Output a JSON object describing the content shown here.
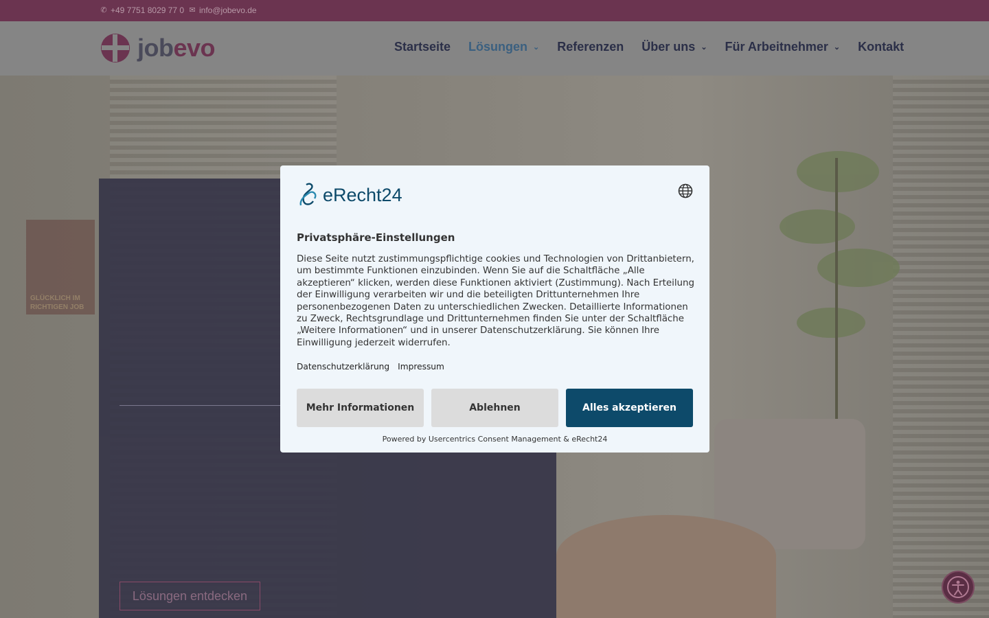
{
  "topbar": {
    "phone": "+49 7751 8029 77 0",
    "email": "info@jobevo.de",
    "phone_icon": "phone-icon",
    "email_icon": "envelope-icon"
  },
  "logo": {
    "text_a": "job",
    "text_b": "evo"
  },
  "nav": {
    "items": [
      {
        "label": "Startseite",
        "dropdown": false
      },
      {
        "label": "Lösungen",
        "dropdown": true,
        "active": true
      },
      {
        "label": "Referenzen",
        "dropdown": false
      },
      {
        "label": "Über uns",
        "dropdown": true
      },
      {
        "label": "Für Arbeitnehmer",
        "dropdown": true
      },
      {
        "label": "Kontakt",
        "dropdown": false
      }
    ]
  },
  "hero": {
    "cta_label": "Lösungen entdecken",
    "poster_text_1": "GLÜCKLICH IM",
    "poster_text_2": "RICHTIGEN JOB"
  },
  "consent": {
    "brand": "eRecht24",
    "title": "Privatsphäre-Einstellungen",
    "body": "Diese Seite nutzt zustimmungspflichtige cookies und Technologien von Drittanbietern, um bestimmte Funktionen einzubinden. Wenn Sie auf die Schaltfläche „Alle akzeptieren“ klicken, werden diese Funktionen aktiviert (Zustimmung). Nach Erteilung der Einwilligung verarbeiten wir und die beteiligten Drittunternehmen Ihre personenbezogenen Daten zu unterschiedlichen Zwecken. Detaillierte Informationen zu Zweck, Rechtsgrundlage und Drittunternehmen finden Sie unter der Schaltfläche „Weitere Informationen“ und in unserer Datenschutzerklärung. Sie können Ihre Einwilligung jederzeit widerrufen.",
    "link_privacy": "Datenschutzerklärung",
    "link_imprint": "Impressum",
    "btn_more": "Mehr Informationen",
    "btn_decline": "Ablehnen",
    "btn_accept": "Alles akzeptieren",
    "powered": "Powered by Usercentrics Consent Management & eRecht24"
  },
  "colors": {
    "topbar": "#6b3450",
    "nav_text": "#2b2f48",
    "nav_active": "#3b6080",
    "accept_button": "#0d4a6a"
  }
}
